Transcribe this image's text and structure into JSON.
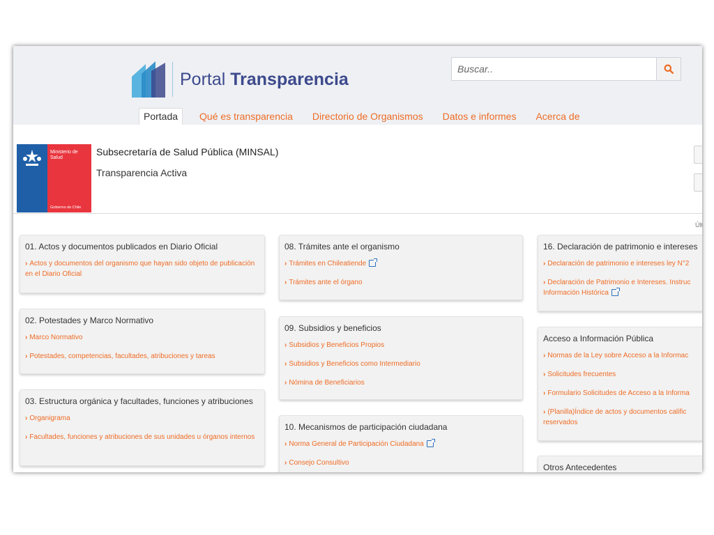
{
  "header": {
    "logo_word1": "Portal",
    "logo_word2": "Transparencia",
    "search_placeholder": "Buscar.."
  },
  "nav": [
    {
      "label": "Portada",
      "active": true
    },
    {
      "label": "Qué es transparencia"
    },
    {
      "label": "Directorio de Organismos"
    },
    {
      "label": "Datos e informes"
    },
    {
      "label": "Acerca de"
    }
  ],
  "organism": {
    "logo_line1": "Ministerio de",
    "logo_line2": "Salud",
    "logo_footer": "Gobierno de Chile",
    "name": "Subsecretaría de Salud Pública (MINSAL)",
    "section": "Transparencia Activa",
    "last_update_label": "Últi"
  },
  "cards": [
    {
      "title": "01. Actos y documentos publicados en Diario Oficial",
      "links": [
        "Actos y documentos del organismo que hayan sido objeto de publicación en el Diario Oficial"
      ]
    },
    {
      "title": "02. Potestades y Marco Normativo",
      "links": [
        "Marco Normativo",
        "Potestades, competencias, facultades, atribuciones y tareas"
      ]
    },
    {
      "title": "03. Estructura orgánica y facultades, funciones y atribuciones",
      "links": [
        "Organigrama",
        "Facultades, funciones y atribuciones de sus unidades u órganos internos"
      ]
    },
    {
      "title": "08. Trámites ante el organismo",
      "links": [
        "Trámites en Chileatiende",
        "Trámites ante el órgano"
      ]
    },
    {
      "title": "09. Subsidios y beneficios",
      "links": [
        "Subsidios y Beneficios Propios",
        "Subsidios y Beneficios como Intermediario",
        "Nómina de Beneficiarios"
      ]
    },
    {
      "title": "10. Mecanismos de participación ciudadana",
      "links": [
        "Norma General de Participación Ciudadana",
        "Consejo Consultivo"
      ]
    },
    {
      "title": "16. Declaración de patrimonio e intereses",
      "links": [
        "Declaración de patrimonio e intereses ley N°2",
        "Declaración de Patrimonio e Intereses. Instruc Información Histórica"
      ]
    },
    {
      "title": "Acceso a Información Pública",
      "links": [
        "Normas de la Ley sobre Acceso a la Informac",
        "Solicitudes frecuentes",
        "Formulario Solicitudes de Acceso a la Informa",
        "(Planilla)Índice de actos y documentos calific reservados"
      ]
    },
    {
      "title": "Otros Antecedentes",
      "links": []
    }
  ],
  "colors": {
    "accent_orange": "#ee6c25",
    "brand_blue": "#3d4a8c",
    "chile_blue": "#1f5fa8",
    "chile_red": "#e9353e"
  },
  "icons": {
    "search": "search-icon",
    "chevron": "chevron-right-icon",
    "external": "external-link-icon"
  }
}
